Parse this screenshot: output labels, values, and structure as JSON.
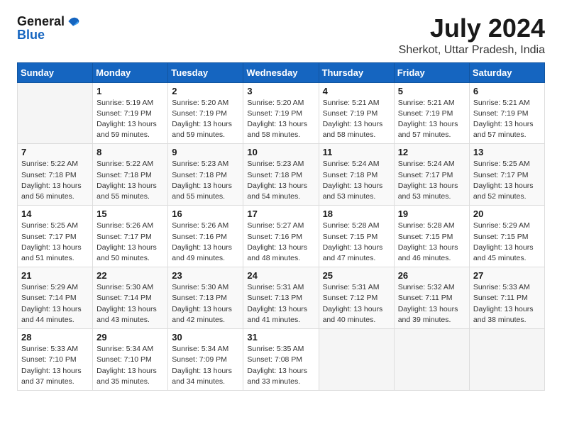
{
  "header": {
    "logo_general": "General",
    "logo_blue": "Blue",
    "month_year": "July 2024",
    "location": "Sherkot, Uttar Pradesh, India"
  },
  "calendar": {
    "days_of_week": [
      "Sunday",
      "Monday",
      "Tuesday",
      "Wednesday",
      "Thursday",
      "Friday",
      "Saturday"
    ],
    "weeks": [
      [
        {
          "day": "",
          "info": ""
        },
        {
          "day": "1",
          "info": "Sunrise: 5:19 AM\nSunset: 7:19 PM\nDaylight: 13 hours\nand 59 minutes."
        },
        {
          "day": "2",
          "info": "Sunrise: 5:20 AM\nSunset: 7:19 PM\nDaylight: 13 hours\nand 59 minutes."
        },
        {
          "day": "3",
          "info": "Sunrise: 5:20 AM\nSunset: 7:19 PM\nDaylight: 13 hours\nand 58 minutes."
        },
        {
          "day": "4",
          "info": "Sunrise: 5:21 AM\nSunset: 7:19 PM\nDaylight: 13 hours\nand 58 minutes."
        },
        {
          "day": "5",
          "info": "Sunrise: 5:21 AM\nSunset: 7:19 PM\nDaylight: 13 hours\nand 57 minutes."
        },
        {
          "day": "6",
          "info": "Sunrise: 5:21 AM\nSunset: 7:19 PM\nDaylight: 13 hours\nand 57 minutes."
        }
      ],
      [
        {
          "day": "7",
          "info": "Sunrise: 5:22 AM\nSunset: 7:18 PM\nDaylight: 13 hours\nand 56 minutes."
        },
        {
          "day": "8",
          "info": "Sunrise: 5:22 AM\nSunset: 7:18 PM\nDaylight: 13 hours\nand 55 minutes."
        },
        {
          "day": "9",
          "info": "Sunrise: 5:23 AM\nSunset: 7:18 PM\nDaylight: 13 hours\nand 55 minutes."
        },
        {
          "day": "10",
          "info": "Sunrise: 5:23 AM\nSunset: 7:18 PM\nDaylight: 13 hours\nand 54 minutes."
        },
        {
          "day": "11",
          "info": "Sunrise: 5:24 AM\nSunset: 7:18 PM\nDaylight: 13 hours\nand 53 minutes."
        },
        {
          "day": "12",
          "info": "Sunrise: 5:24 AM\nSunset: 7:17 PM\nDaylight: 13 hours\nand 53 minutes."
        },
        {
          "day": "13",
          "info": "Sunrise: 5:25 AM\nSunset: 7:17 PM\nDaylight: 13 hours\nand 52 minutes."
        }
      ],
      [
        {
          "day": "14",
          "info": "Sunrise: 5:25 AM\nSunset: 7:17 PM\nDaylight: 13 hours\nand 51 minutes."
        },
        {
          "day": "15",
          "info": "Sunrise: 5:26 AM\nSunset: 7:17 PM\nDaylight: 13 hours\nand 50 minutes."
        },
        {
          "day": "16",
          "info": "Sunrise: 5:26 AM\nSunset: 7:16 PM\nDaylight: 13 hours\nand 49 minutes."
        },
        {
          "day": "17",
          "info": "Sunrise: 5:27 AM\nSunset: 7:16 PM\nDaylight: 13 hours\nand 48 minutes."
        },
        {
          "day": "18",
          "info": "Sunrise: 5:28 AM\nSunset: 7:15 PM\nDaylight: 13 hours\nand 47 minutes."
        },
        {
          "day": "19",
          "info": "Sunrise: 5:28 AM\nSunset: 7:15 PM\nDaylight: 13 hours\nand 46 minutes."
        },
        {
          "day": "20",
          "info": "Sunrise: 5:29 AM\nSunset: 7:15 PM\nDaylight: 13 hours\nand 45 minutes."
        }
      ],
      [
        {
          "day": "21",
          "info": "Sunrise: 5:29 AM\nSunset: 7:14 PM\nDaylight: 13 hours\nand 44 minutes."
        },
        {
          "day": "22",
          "info": "Sunrise: 5:30 AM\nSunset: 7:14 PM\nDaylight: 13 hours\nand 43 minutes."
        },
        {
          "day": "23",
          "info": "Sunrise: 5:30 AM\nSunset: 7:13 PM\nDaylight: 13 hours\nand 42 minutes."
        },
        {
          "day": "24",
          "info": "Sunrise: 5:31 AM\nSunset: 7:13 PM\nDaylight: 13 hours\nand 41 minutes."
        },
        {
          "day": "25",
          "info": "Sunrise: 5:31 AM\nSunset: 7:12 PM\nDaylight: 13 hours\nand 40 minutes."
        },
        {
          "day": "26",
          "info": "Sunrise: 5:32 AM\nSunset: 7:11 PM\nDaylight: 13 hours\nand 39 minutes."
        },
        {
          "day": "27",
          "info": "Sunrise: 5:33 AM\nSunset: 7:11 PM\nDaylight: 13 hours\nand 38 minutes."
        }
      ],
      [
        {
          "day": "28",
          "info": "Sunrise: 5:33 AM\nSunset: 7:10 PM\nDaylight: 13 hours\nand 37 minutes."
        },
        {
          "day": "29",
          "info": "Sunrise: 5:34 AM\nSunset: 7:10 PM\nDaylight: 13 hours\nand 35 minutes."
        },
        {
          "day": "30",
          "info": "Sunrise: 5:34 AM\nSunset: 7:09 PM\nDaylight: 13 hours\nand 34 minutes."
        },
        {
          "day": "31",
          "info": "Sunrise: 5:35 AM\nSunset: 7:08 PM\nDaylight: 13 hours\nand 33 minutes."
        },
        {
          "day": "",
          "info": ""
        },
        {
          "day": "",
          "info": ""
        },
        {
          "day": "",
          "info": ""
        }
      ]
    ]
  }
}
